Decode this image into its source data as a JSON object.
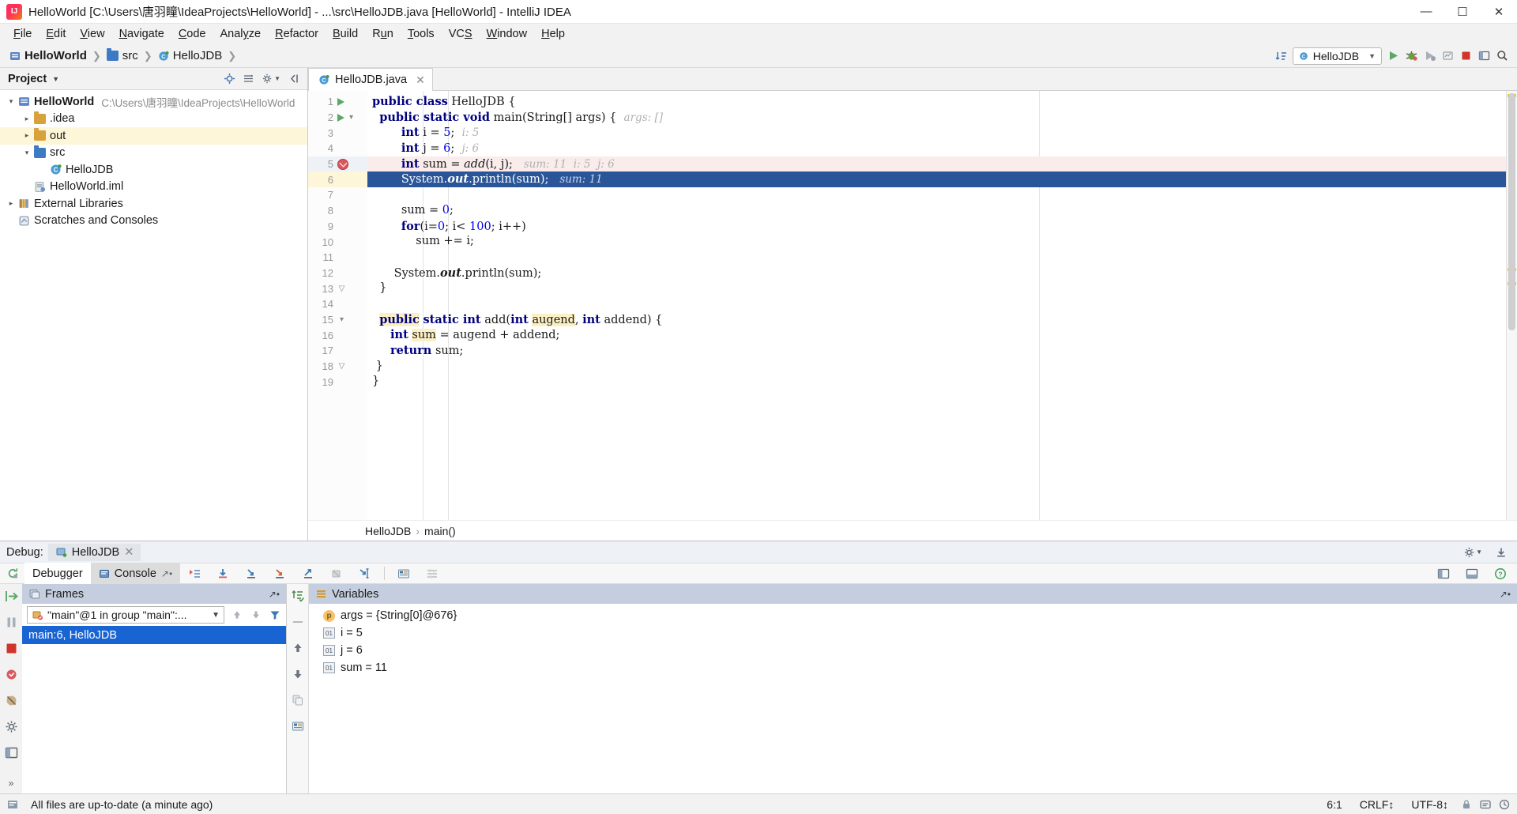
{
  "window": {
    "title": "HelloWorld [C:\\Users\\唐羽瞳\\IdeaProjects\\HelloWorld] - ...\\src\\HelloJDB.java [HelloWorld] - IntelliJ IDEA",
    "minimize_label": "—",
    "maximize_label": "☐",
    "close_label": "✕",
    "app_icon": "intellij-idea-icon"
  },
  "menu": {
    "items": [
      {
        "label": "File",
        "mnemonic": "F"
      },
      {
        "label": "Edit",
        "mnemonic": "E"
      },
      {
        "label": "View",
        "mnemonic": "V"
      },
      {
        "label": "Navigate",
        "mnemonic": "N"
      },
      {
        "label": "Code",
        "mnemonic": "C"
      },
      {
        "label": "Analyze",
        "mnemonic": "y"
      },
      {
        "label": "Refactor",
        "mnemonic": "R"
      },
      {
        "label": "Build",
        "mnemonic": "B"
      },
      {
        "label": "Run",
        "mnemonic": "u"
      },
      {
        "label": "Tools",
        "mnemonic": "T"
      },
      {
        "label": "VCS",
        "mnemonic": "S"
      },
      {
        "label": "Window",
        "mnemonic": "W"
      },
      {
        "label": "Help",
        "mnemonic": "H"
      }
    ]
  },
  "navbar": {
    "breadcrumbs": [
      "HelloWorld",
      "src",
      "HelloJDB"
    ],
    "run_config": "HelloJDB",
    "icons": [
      "sort-toggle-icon",
      "run-icon",
      "debug-icon",
      "run-coverage-icon",
      "attach-profiler-icon",
      "stop-icon",
      "layout-icon",
      "search-everywhere-icon"
    ]
  },
  "project_panel": {
    "title": "Project",
    "toolbar_icons": [
      "locate-icon",
      "expand-collapse-icon",
      "gear-icon",
      "hide-icon"
    ],
    "tree": [
      {
        "label": "HelloWorld",
        "path": "C:\\Users\\唐羽瞳\\IdeaProjects\\HelloWorld",
        "indent": 0,
        "arrow": "▾",
        "icon": "project-icon",
        "bold": true,
        "selected": false
      },
      {
        "label": ".idea",
        "path": "",
        "indent": 1,
        "arrow": "▸",
        "icon": "folder-icon",
        "bold": false,
        "selected": false,
        "color": "#d8a13c"
      },
      {
        "label": "out",
        "path": "",
        "indent": 1,
        "arrow": "▸",
        "icon": "folder-icon",
        "bold": false,
        "selected": true,
        "color": "#d8a13c"
      },
      {
        "label": "src",
        "path": "",
        "indent": 1,
        "arrow": "▾",
        "icon": "source-folder-icon",
        "bold": false,
        "selected": false,
        "color": "#3d7ac4"
      },
      {
        "label": "HelloJDB",
        "path": "",
        "indent": 2,
        "arrow": "",
        "icon": "java-class-icon",
        "bold": false,
        "selected": false
      },
      {
        "label": "HelloWorld.iml",
        "path": "",
        "indent": 1,
        "arrow": "",
        "icon": "iml-file-icon",
        "bold": false,
        "selected": false
      },
      {
        "label": "External Libraries",
        "path": "",
        "indent": 0,
        "arrow": "▸",
        "icon": "libraries-icon",
        "bold": false,
        "selected": false
      },
      {
        "label": "Scratches and Consoles",
        "path": "",
        "indent": 0,
        "arrow": "",
        "icon": "scratches-icon",
        "bold": false,
        "selected": false
      }
    ]
  },
  "editor": {
    "tab": {
      "label": "HelloJDB.java",
      "icon": "java-class-icon",
      "close": "✕"
    },
    "breadcrumb": [
      "HelloJDB",
      "main()"
    ],
    "breadcrumb_sep": "›",
    "lines": [
      {
        "n": 1,
        "gutter": "run",
        "fold": "",
        "state": "",
        "html": "<span class='kw'>public class</span> HelloJDB {"
      },
      {
        "n": 2,
        "gutter": "run",
        "fold": "collapse",
        "state": "",
        "html": "  <span class='kw'>public static void</span> main(String[] args) {  <span class='hint'>args: []</span>"
      },
      {
        "n": 3,
        "gutter": "",
        "fold": "",
        "state": "",
        "html": "        <span class='kw'>int</span> i = <span class='num'>5</span>;  <span class='hint'>i: 5</span>"
      },
      {
        "n": 4,
        "gutter": "",
        "fold": "",
        "state": "",
        "html": "        <span class='kw'>int</span> j = <span class='num'>6</span>;  <span class='hint'>j: 6</span>"
      },
      {
        "n": 5,
        "gutter": "bp",
        "fold": "",
        "state": "hl-red",
        "html": "        <span class='kw'>int</span> sum = <span class='mth'>add</span>(i, j);   <span class='hint'>sum: 11  i: 5  j: 6</span>"
      },
      {
        "n": 6,
        "gutter": "",
        "fold": "",
        "state": "hl-sel",
        "html": "        System.<b><i>out</i></b>.println(sum);   <span class='hint' style='color:#c8d6ee'>sum: 11</span>"
      },
      {
        "n": 7,
        "gutter": "",
        "fold": "",
        "state": "",
        "html": ""
      },
      {
        "n": 8,
        "gutter": "",
        "fold": "",
        "state": "",
        "html": "        sum = <span class='num'>0</span>;"
      },
      {
        "n": 9,
        "gutter": "",
        "fold": "",
        "state": "",
        "html": "        <span class='kw'>for</span>(i=<span class='num'>0</span>; i&lt; <span class='num'>100</span>; i++)"
      },
      {
        "n": 10,
        "gutter": "",
        "fold": "",
        "state": "",
        "html": "            sum += i;"
      },
      {
        "n": 11,
        "gutter": "",
        "fold": "",
        "state": "",
        "html": ""
      },
      {
        "n": 12,
        "gutter": "",
        "fold": "",
        "state": "",
        "html": "      System.<b><i>out</i></b>.println(sum);"
      },
      {
        "n": 13,
        "gutter": "",
        "fold": "expand",
        "state": "",
        "html": "  }"
      },
      {
        "n": 14,
        "gutter": "",
        "fold": "",
        "state": "",
        "html": ""
      },
      {
        "n": 15,
        "gutter": "",
        "fold": "collapse",
        "state": "",
        "html": "  <span class='kw yel'>public</span> <span class='kw'>static int</span> add(<span class='kw'>int</span> <span class='yel'>augend</span>, <span class='kw'>int</span> addend) {"
      },
      {
        "n": 16,
        "gutter": "",
        "fold": "",
        "state": "",
        "html": "     <span class='kw'>int</span> <span class='yel'>sum</span> = augend + addend;"
      },
      {
        "n": 17,
        "gutter": "",
        "fold": "",
        "state": "",
        "html": "     <span class='kw'>return</span> sum;"
      },
      {
        "n": 18,
        "gutter": "",
        "fold": "expand",
        "state": "",
        "html": " }"
      },
      {
        "n": 19,
        "gutter": "",
        "fold": "",
        "state": "",
        "html": "}"
      }
    ]
  },
  "debug": {
    "label": "Debug:",
    "session": "HelloJDB",
    "session_close": "✕",
    "tabs": [
      {
        "label": "Debugger",
        "icon": "debugger-icon",
        "active": true
      },
      {
        "label": "Console",
        "icon": "console-icon",
        "active": false
      }
    ],
    "toolbar_icons": [
      "show-execution-point-icon",
      "step-over-icon",
      "step-into-icon",
      "force-step-into-icon",
      "step-out-icon",
      "drop-frame-icon",
      "run-to-cursor-icon",
      "evaluate-expression-icon",
      "settings-icon"
    ],
    "rail_icons": [
      "resume-icon",
      "pause-icon",
      "stop-icon",
      "view-breakpoints-icon",
      "mute-breakpoints-icon",
      "settings-icon",
      "layout-icon"
    ],
    "frames": {
      "title": "Frames",
      "thread": "\"main\"@1 in group \"main\":...",
      "thread_caret": "⌄",
      "controls": [
        "up-arrow-icon",
        "down-arrow-icon",
        "filter-icon"
      ],
      "rows": [
        {
          "label": "main:6, HelloJDB",
          "selected": true
        }
      ]
    },
    "variables": {
      "title": "Variables",
      "rail_icons": [
        "watch-icon",
        "remove-icon",
        "up-icon",
        "down-icon",
        "copy-icon",
        "evaluate-icon"
      ],
      "rows": [
        {
          "icon": "parameter-icon",
          "text": "args = {String[0]@676}"
        },
        {
          "icon": "primitive-icon",
          "text": "i = 5"
        },
        {
          "icon": "primitive-icon",
          "text": "j = 6"
        },
        {
          "icon": "primitive-icon",
          "text": "sum = 11"
        }
      ]
    }
  },
  "statusbar": {
    "message": "All files are up-to-date (a minute ago)",
    "caret": "6:1",
    "line_sep": "CRLF↕",
    "encoding": "UTF-8↕",
    "icons": [
      "build-icon",
      "lock-icon",
      "event-log-icon",
      "memory-icon"
    ]
  }
}
